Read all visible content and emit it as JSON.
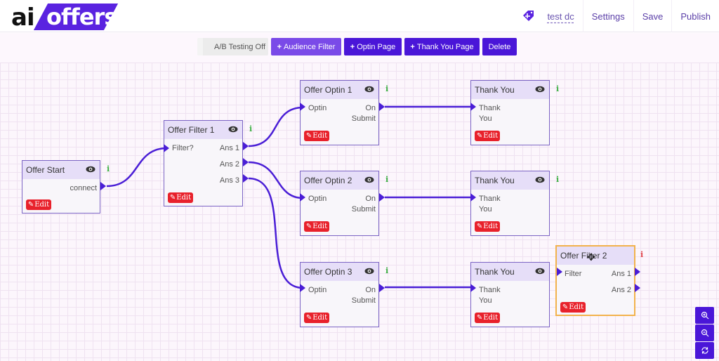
{
  "header": {
    "logo_prefix": "ai",
    "logo_suffix": "offers",
    "user": "test dc",
    "nav": [
      "Settings",
      "Save",
      "Publish"
    ],
    "brand_color": "#5a23e0"
  },
  "toolbar": {
    "ab_testing": "A/B Testing Off",
    "audience_filter": "Audience Filter",
    "optin_page": "Optin Page",
    "thank_you_page": "Thank You Page",
    "delete": "Delete",
    "plus": "+"
  },
  "edit_label": "Edit",
  "info_glyph": "i",
  "nodes": {
    "start": {
      "title": "Offer Start",
      "outputs": [
        "connect"
      ]
    },
    "filter1": {
      "title": "Offer Filter 1",
      "input": "Filter?",
      "outputs": [
        "Ans 1",
        "Ans 2",
        "Ans 3"
      ]
    },
    "optin1": {
      "title": "Offer Optin 1",
      "input": "Optin",
      "output_line1": "On",
      "output_line2": "Submit"
    },
    "optin2": {
      "title": "Offer Optin 2",
      "input": "Optin",
      "output_line1": "On",
      "output_line2": "Submit"
    },
    "optin3": {
      "title": "Offer Optin 3",
      "input": "Optin",
      "output_line1": "On",
      "output_line2": "Submit"
    },
    "ty1": {
      "title": "Thank You",
      "input_line1": "Thank",
      "input_line2": "You"
    },
    "ty2": {
      "title": "Thank You",
      "input_line1": "Thank",
      "input_line2": "You"
    },
    "ty3": {
      "title": "Thank You",
      "input_line1": "Thank",
      "input_line2": "You"
    },
    "filter2": {
      "title": "Offer Filter 2",
      "input": "Filter",
      "outputs": [
        "Ans 1",
        "Ans 2"
      ]
    }
  },
  "connections": [
    [
      "start.connect",
      "filter1.input"
    ],
    [
      "filter1.ans1",
      "optin1.input"
    ],
    [
      "filter1.ans2",
      "optin2.input"
    ],
    [
      "filter1.ans3",
      "optin3.input"
    ],
    [
      "optin1.submit",
      "ty1.input"
    ],
    [
      "optin2.submit",
      "ty2.input"
    ],
    [
      "optin3.submit",
      "ty3.input"
    ]
  ],
  "zoom_controls": [
    "zoom-in",
    "zoom-out",
    "reset"
  ]
}
